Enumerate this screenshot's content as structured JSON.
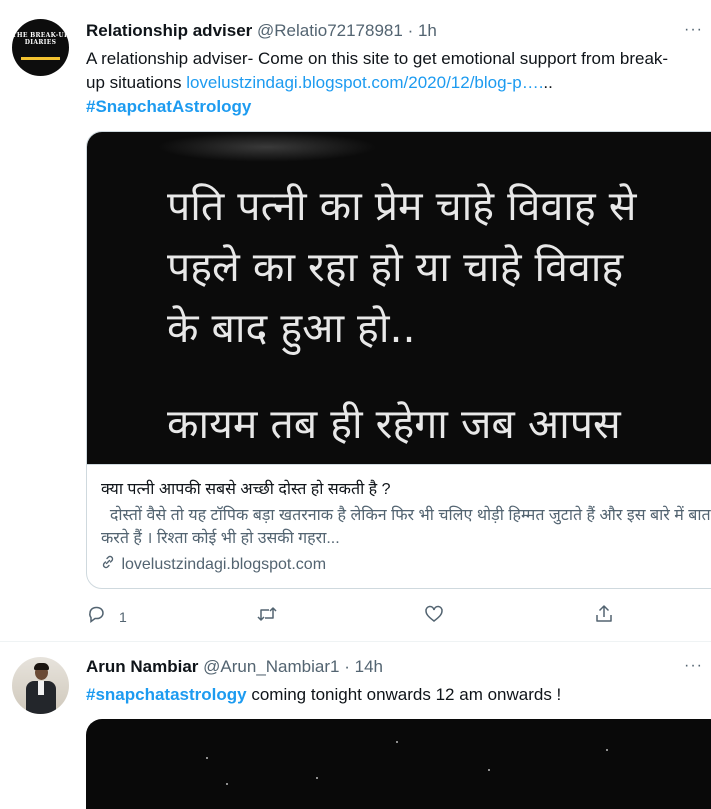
{
  "tweet1": {
    "display_name": "Relationship adviser",
    "handle": "@Relatio72178981",
    "separator": "·",
    "time": "1h",
    "avatar_text": "THE BREAK-UP DIARIES",
    "text_prefix": "A relationship adviser- Come on this site to get emotional support from break-up situations ",
    "link": "lovelustzindagi.blogspot.com/2020/12/blog-p….",
    "link_suffix": "..",
    "hashtag": "#SnapchatAstrology",
    "image_lines": [
      "पति पत्नी का प्रेम चाहे विवाह से",
      "पहले का रहा हो या चाहे विवाह",
      "के बाद हुआ हो..",
      "कायम तब ही रहेगा जब आपस"
    ],
    "card_title": "क्या पत्नी आपकी सबसे अच्छी दोस्त हो सकती है ?",
    "card_description": "  दोस्तों वैसे तो यह टॉपिक बड़ा खतरनाक है लेकिन फिर भी चलिए थोड़ी हिम्मत जुटाते हैं और इस बारे में बात करते हैं । रिश्ता कोई भी हो उसकी गहरा...",
    "card_domain": "lovelustzindagi.blogspot.com",
    "reply_count": "1",
    "icons": {
      "more": "more-icon",
      "reply": "reply-icon",
      "retweet": "retweet-icon",
      "like": "like-icon",
      "share": "share-icon",
      "link": "link-icon"
    }
  },
  "tweet2": {
    "display_name": "Arun Nambiar",
    "handle": "@Arun_Nambiar1",
    "separator": "·",
    "time": "14h",
    "hashtag": "#snapchatastrology",
    "text_suffix": " coming tonight onwards 12 am onwards !"
  },
  "colors": {
    "link": "#1d9bf0",
    "secondary_text": "#536471",
    "border": "#cfd9de"
  }
}
